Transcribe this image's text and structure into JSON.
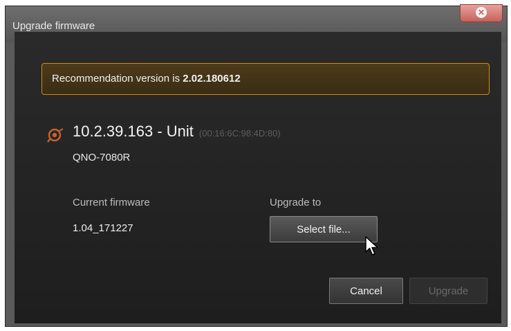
{
  "window": {
    "title": "Upgrade firmware",
    "close_icon": "close-icon"
  },
  "banner": {
    "prefix": "Recommendation version is ",
    "version": "2.02.180612",
    "color": "#d08a1c"
  },
  "unit": {
    "icon": "camera-status-icon",
    "name": "10.2.39.163 - Unit",
    "mac": "(00:16:6C:98:4D:80)",
    "model": "QNO-7080R"
  },
  "firmware": {
    "current_label": "Current firmware",
    "current_value": "1.04_171227",
    "upgrade_label": "Upgrade to",
    "select_button": "Select file..."
  },
  "actions": {
    "cancel": "Cancel",
    "upgrade": "Upgrade",
    "upgrade_enabled": false
  }
}
